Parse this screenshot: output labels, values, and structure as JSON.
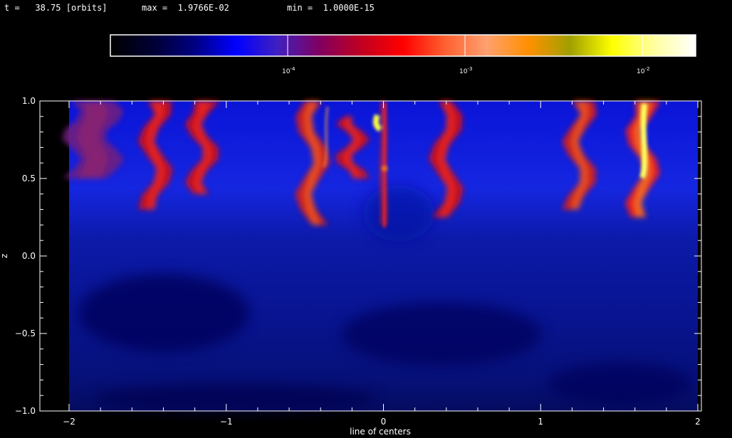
{
  "header": {
    "time_label": "t =",
    "time_value": "38.75",
    "time_unit": "[orbits]",
    "max_label": "max =",
    "max_value": "1.9766E-02",
    "min_label": "min =",
    "min_value": "1.0000E-15"
  },
  "colorbar": {
    "tick_labels": [
      "10",
      "10",
      "10"
    ],
    "tick_exponents": [
      "-4",
      "-3",
      "-2"
    ],
    "tick_values": [
      0.0001,
      0.001,
      0.01
    ],
    "range": [
      1e-05,
      0.02
    ],
    "colors": [
      "#000000",
      "#000033",
      "#000080",
      "#0000ff",
      "#4020c0",
      "#800060",
      "#c00020",
      "#ff0000",
      "#ff6030",
      "#ffa070",
      "#ff9000",
      "#a0a000",
      "#ffff00",
      "#ffffa0",
      "#ffffff"
    ]
  },
  "chart_data": {
    "type": "heatmap",
    "title": "",
    "xlabel": "line of centers",
    "ylabel": "z",
    "xlim": [
      -2.1,
      2.05
    ],
    "ylim": [
      -1.0,
      1.0
    ],
    "x_ticks": [
      -2,
      -1,
      0,
      1,
      2
    ],
    "x_tick_labels": [
      "−2",
      "−1",
      "0",
      "1",
      "2"
    ],
    "y_ticks": [
      -1.0,
      -0.5,
      0.0,
      0.5,
      1.0
    ],
    "y_tick_labels": [
      "−1.0",
      "−0.5",
      "0.0",
      "0.5",
      "1.0"
    ],
    "features": [
      {
        "x": -1.85,
        "z_top": 1.0,
        "z_bottom": 0.5,
        "level": "red-purple"
      },
      {
        "x": -1.45,
        "z_top": 1.0,
        "z_bottom": 0.3,
        "level": "red"
      },
      {
        "x": -1.15,
        "z_top": 1.0,
        "z_bottom": 0.4,
        "level": "red"
      },
      {
        "x": -0.45,
        "z_top": 1.0,
        "z_bottom": 0.2,
        "level": "red-orange"
      },
      {
        "x": -0.2,
        "z_top": 0.9,
        "z_bottom": 0.5,
        "level": "red"
      },
      {
        "x": 0.0,
        "z_top": 1.0,
        "z_bottom": 0.2,
        "level": "red-yellow"
      },
      {
        "x": 0.4,
        "z_top": 1.0,
        "z_bottom": 0.25,
        "level": "red"
      },
      {
        "x": 1.25,
        "z_top": 1.0,
        "z_bottom": 0.3,
        "level": "red-orange"
      },
      {
        "x": 1.65,
        "z_top": 1.0,
        "z_bottom": 0.25,
        "level": "yellow-white"
      }
    ],
    "background_level": "blue"
  }
}
